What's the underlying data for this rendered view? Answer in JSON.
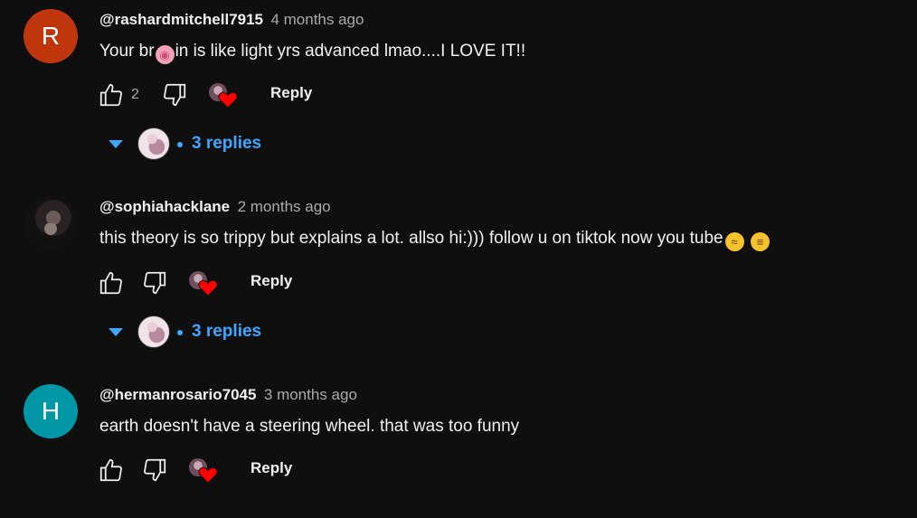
{
  "comments": [
    {
      "author": "@rashardmitchell7915",
      "time": "4 months ago",
      "avatar_letter": "R",
      "avatar_color": "#bf360c",
      "text_before": "Your br",
      "text_after": "in is like light yrs advanced lmao....I LOVE IT!!",
      "like_count": "2",
      "reply_label": "Reply",
      "replies_label": "3 replies"
    },
    {
      "author": "@sophiahacklane",
      "time": "2 months ago",
      "avatar_letter": "",
      "text": "this theory is so trippy but explains a lot. allso hi:))) follow u on tiktok now you tube",
      "like_count": "",
      "reply_label": "Reply",
      "replies_label": "3 replies"
    },
    {
      "author": "@hermanrosario7045",
      "time": "3 months ago",
      "avatar_letter": "H",
      "avatar_color": "#0097a7",
      "text": "earth doesn't have a steering wheel. that was too funny",
      "like_count": "",
      "reply_label": "Reply"
    }
  ],
  "colors": {
    "background": "#0f0f0f",
    "link_blue": "#3ea6ff",
    "heart_red": "#ff0000",
    "secondary_text": "#aaaaaa"
  },
  "icons": [
    "thumbs-up-icon",
    "thumbs-down-icon",
    "creator-heart-icon",
    "caret-down-icon",
    "brain-emoji",
    "laughing-emoji",
    "grinning-emoji"
  ]
}
